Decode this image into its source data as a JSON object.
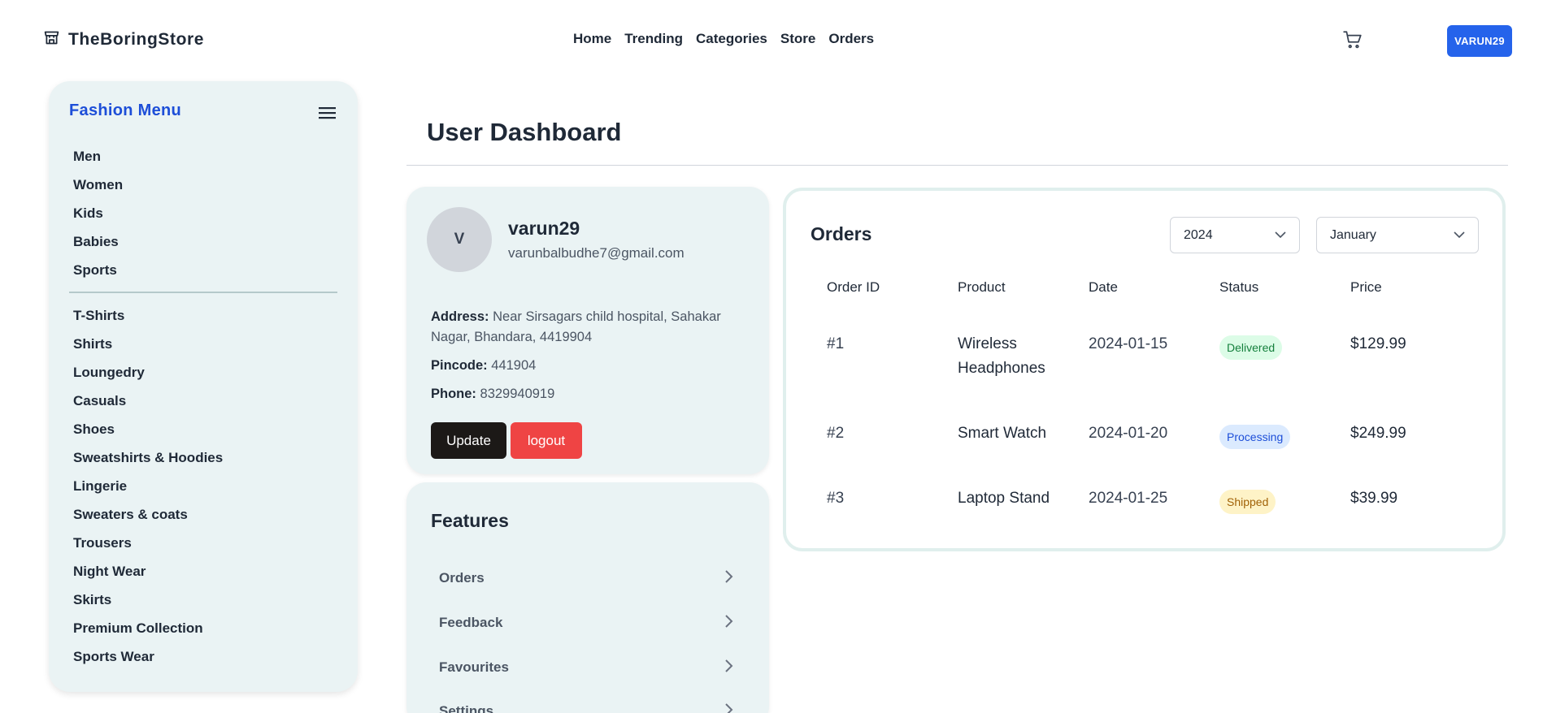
{
  "header": {
    "brand": "TheBoringStore",
    "nav": [
      "Home",
      "Trending",
      "Categories",
      "Store",
      "Orders"
    ],
    "user_button": "VARUN29"
  },
  "sidebar": {
    "title": "Fashion Menu",
    "groups": [
      [
        "Men",
        "Women",
        "Kids",
        "Babies",
        "Sports"
      ],
      [
        "T-Shirts",
        "Shirts",
        "Loungedry",
        "Casuals",
        "Shoes",
        "Sweatshirts & Hoodies",
        "Lingerie",
        "Sweaters & coats",
        "Trousers",
        "Night Wear",
        "Skirts",
        "Premium Collection",
        "Sports Wear"
      ]
    ]
  },
  "dashboard": {
    "title": "User Dashboard"
  },
  "profile": {
    "avatar_initial": "V",
    "username": "varun29",
    "email": "varunbalbudhe7@gmail.com",
    "address_label": "Address:",
    "address": "Near Sirsagars child hospital, Sahakar Nagar, Bhandara, 4419904",
    "pincode_label": "Pincode:",
    "pincode": "441904",
    "phone_label": "Phone:",
    "phone": "8329940919",
    "update_label": "Update",
    "logout_label": "logout"
  },
  "features": {
    "title": "Features",
    "items": [
      "Orders",
      "Feedback",
      "Favourites",
      "Settings"
    ]
  },
  "orders": {
    "title": "Orders",
    "year": "2024",
    "month": "January",
    "columns": [
      "Order ID",
      "Product",
      "Date",
      "Status",
      "Price"
    ],
    "rows": [
      {
        "id": "#1",
        "product": "Wireless Headphones",
        "date": "2024-01-15",
        "status": "Delivered",
        "price": "$129.99"
      },
      {
        "id": "#2",
        "product": "Smart Watch",
        "date": "2024-01-20",
        "status": "Processing",
        "price": "$249.99"
      },
      {
        "id": "#3",
        "product": "Laptop Stand",
        "date": "2024-01-25",
        "status": "Shipped",
        "price": "$39.99"
      }
    ]
  },
  "colors": {
    "primary": "#2563eb",
    "panel": "#eaf3f4",
    "logout": "#ef4444",
    "delivered": "#dcfce7",
    "processing": "#dbeafe",
    "shipped": "#fef3c7"
  },
  "icons": {
    "brand": "store-icon",
    "cart": "cart-icon",
    "menu": "hamburger-icon",
    "select": "chevron-down-icon",
    "feature": "chevron-right-icon"
  }
}
